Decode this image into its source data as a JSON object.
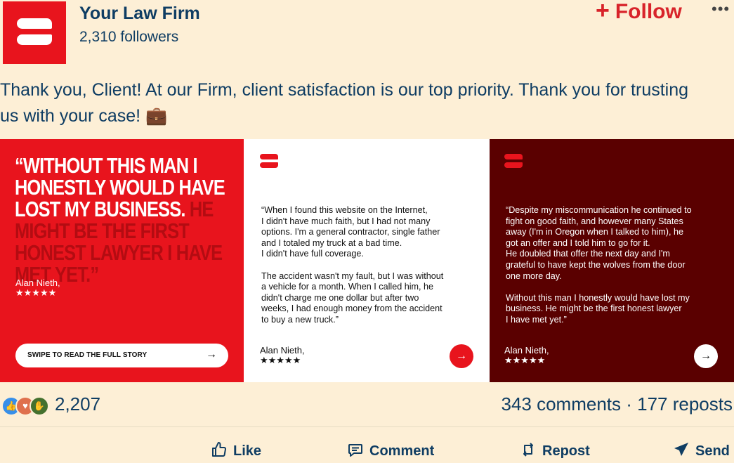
{
  "header": {
    "firm_name": "Your Law Firm",
    "followers": "2,310 followers",
    "follow_label": "Follow",
    "more_label": "•••"
  },
  "post": {
    "text": "Thank you, Client! At our Firm, client satisfaction is our top priority. Thank you for trusting us with your case! 💼"
  },
  "carousel": {
    "card1": {
      "headline_a": "“WITHOUT THIS MAN I HONESTLY WOULD HAVE LOST MY BUSINESS.",
      "headline_b": " HE MIGHT BE THE FIRST HONEST LAWYER I HAVE MET YET.”",
      "author": "Alan Nieth,",
      "stars": "★★★★★",
      "swipe_label": "SWIPE TO READ THE FULL STORY",
      "arrow": "→"
    },
    "card2": {
      "quote": "“When I found this website on the Internet,\nI didn't have much faith, but I had not many\noptions. I'm a general contractor, single father\nand I totaled my truck at a bad time.\nI didn't have full coverage.\n\nThe accident wasn't my fault, but I was without\na vehicle for a month. When I called him, he\ndidn't charge me one dollar but after two\nweeks, I had enough money from the accident\nto buy a new truck.”",
      "author": "Alan Nieth,",
      "stars": "★★★★★",
      "arrow": "→"
    },
    "card3": {
      "quote": "“Despite my miscommunication he continued to\nfight on good faith, and however many States\naway (I'm in Oregon when I talked to him), he\ngot an offer and I told him to go for it.\nHe doubled that offer the next day and I'm\ngrateful to have kept the wolves from the door\none more day.\n\nWithout this man I honestly would have lost my\nbusiness. He might be the first honest lawyer\nI have met yet.”",
      "author": "Alan Nieth,",
      "stars": "★★★★★",
      "arrow": "→"
    }
  },
  "social": {
    "reaction_count": "2,207",
    "comments": "343 comments",
    "separator": " · ",
    "reposts": "177 reposts"
  },
  "actions": {
    "like": "Like",
    "comment": "Comment",
    "repost": "Repost",
    "send": "Send"
  },
  "colors": {
    "brand_red": "#e8141d",
    "dark_red": "#5a0000",
    "text_navy": "#0f3d63",
    "background": "#fdefd6"
  }
}
